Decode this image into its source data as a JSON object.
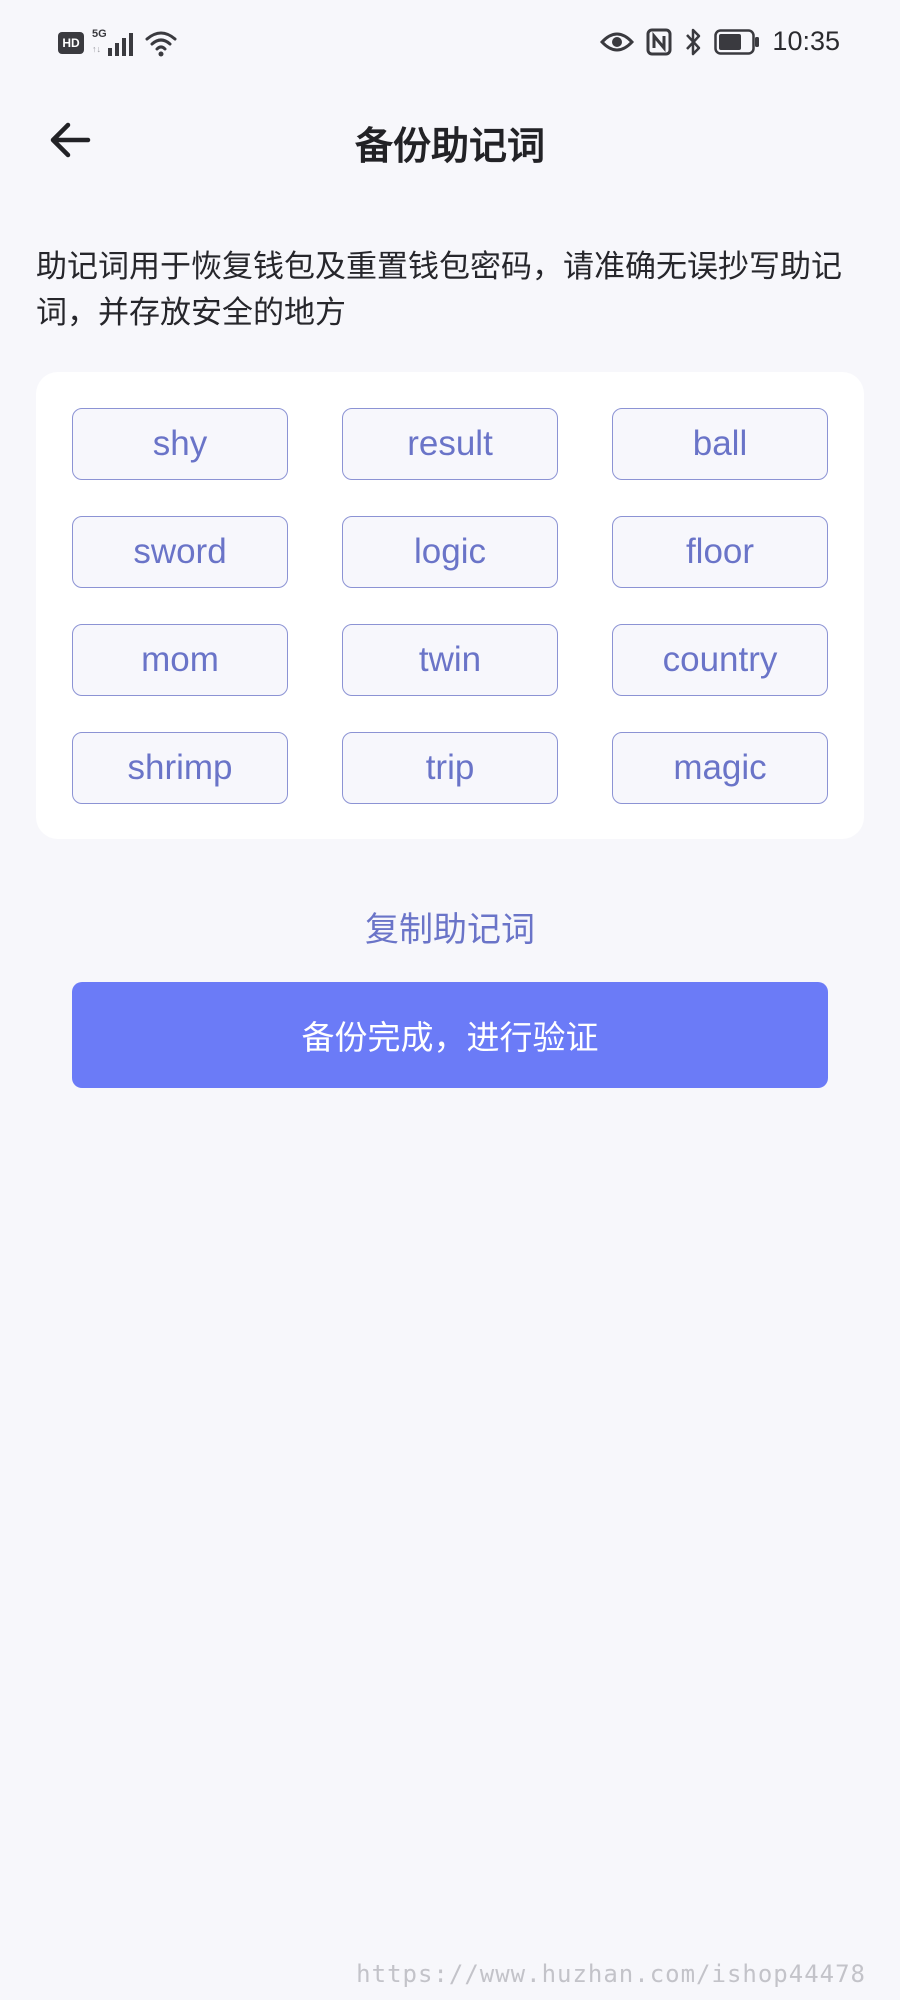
{
  "status_bar": {
    "hd_label": "HD",
    "network_label": "5G",
    "network_arrows": "↑↓",
    "time": "10:35",
    "icons": [
      "signal-icon",
      "wifi-icon",
      "eye-icon",
      "nfc-icon",
      "bluetooth-icon",
      "battery-icon"
    ]
  },
  "header": {
    "title": "备份助记词",
    "back_icon": "arrow-left-icon"
  },
  "description": "助记词用于恢复钱包及重置钱包密码，请准确无误抄写助记词，并存放安全的地方",
  "mnemonic_words": [
    "shy",
    "result",
    "ball",
    "sword",
    "logic",
    "floor",
    "mom",
    "twin",
    "country",
    "shrimp",
    "trip",
    "magic"
  ],
  "actions": {
    "copy_label": "复制助记词",
    "confirm_label": "备份完成，进行验证"
  },
  "colors": {
    "accent": "#6b7bf7",
    "word_text": "#6a74c8",
    "word_border": "#8c93d4",
    "background": "#f7f7fb"
  },
  "watermark": "https://www.huzhan.com/ishop44478"
}
